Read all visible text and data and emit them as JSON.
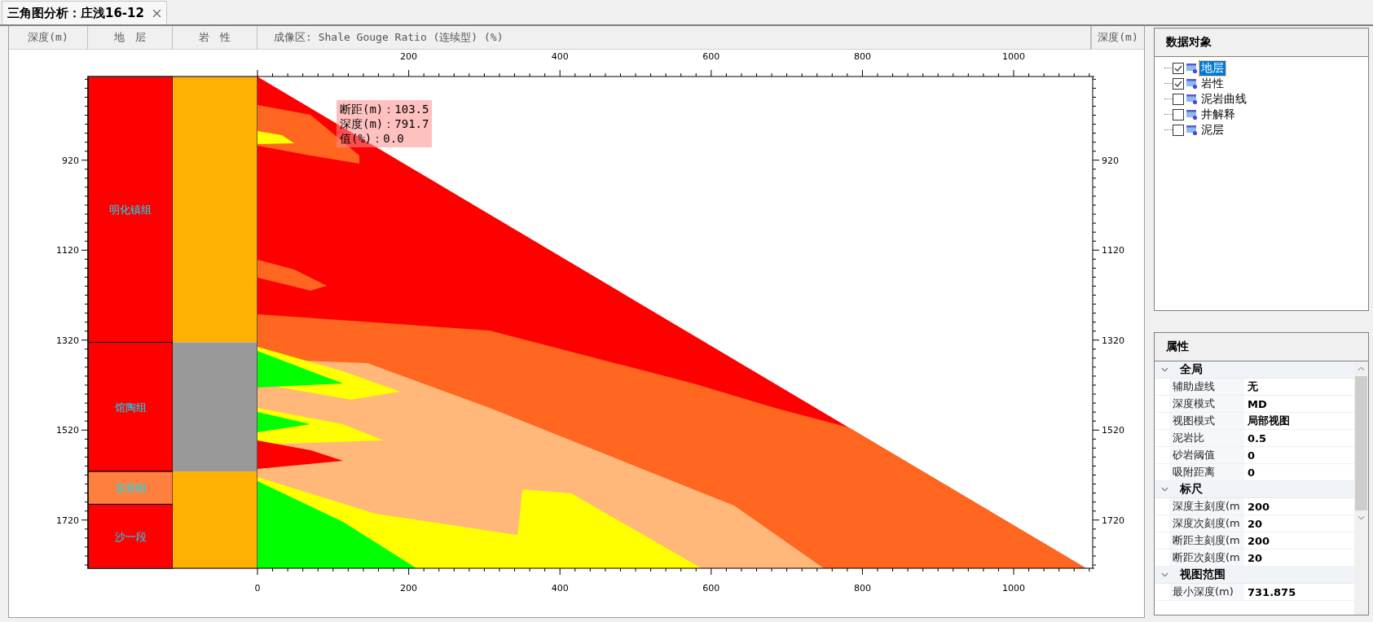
{
  "tab": {
    "title": "三角图分析：庄浅16-12",
    "selected": true
  },
  "header": {
    "columns": [
      "深度(m)",
      "地　层",
      "岩　性",
      "成像区: Shale Gouge Ratio (连续型) (%)",
      "深度(m)"
    ]
  },
  "plot": {
    "top_axis_labels": [
      "200",
      "400",
      "600",
      "800",
      "1000"
    ],
    "bottom_axis_labels": [
      "0",
      "200",
      "400",
      "600",
      "800",
      "1000"
    ],
    "left_axis_labels": [
      "920",
      "1120",
      "1320",
      "1520",
      "1720"
    ],
    "right_axis_labels": [
      "920",
      "1120",
      "1320",
      "1520",
      "1720"
    ],
    "strata": [
      {
        "name": "明化镇组",
        "color": "#ff0000"
      },
      {
        "name": "馆陶组",
        "color": "#ff0000"
      },
      {
        "name": "东营组",
        "color": "#ff7f3f"
      },
      {
        "name": "沙一段",
        "color": "#ff0000"
      }
    ],
    "lithology": [
      {
        "color": "#ffb000"
      },
      {
        "color": "#999999"
      },
      {
        "color": "#ffb000"
      }
    ],
    "tooltip": [
      "断距(m)：103.5",
      "深度(m)：791.7",
      "值(%)：0.0"
    ]
  },
  "data_objects": {
    "title": "数据对象",
    "items": [
      {
        "label": "地层",
        "checked": true,
        "selected": true
      },
      {
        "label": "岩性",
        "checked": true,
        "selected": false
      },
      {
        "label": "泥岩曲线",
        "checked": false,
        "selected": false
      },
      {
        "label": "井解释",
        "checked": false,
        "selected": false
      },
      {
        "label": "泥层",
        "checked": false,
        "selected": false
      }
    ]
  },
  "properties": {
    "title": "属性",
    "groups": [
      {
        "label": "全局",
        "expanded": true,
        "rows": [
          {
            "name": "辅助虚线",
            "value": "无"
          },
          {
            "name": "深度模式",
            "value": "MD"
          },
          {
            "name": "视图模式",
            "value": "局部视图"
          },
          {
            "name": "泥岩比",
            "value": "0.5"
          },
          {
            "name": "砂岩阈值",
            "value": "0"
          },
          {
            "name": "吸附距离",
            "value": "0"
          }
        ]
      },
      {
        "label": "标尺",
        "expanded": true,
        "rows": [
          {
            "name": "深度主刻度(m",
            "value": "200"
          },
          {
            "name": "深度次刻度(m",
            "value": "20"
          },
          {
            "name": "断距主刻度(m",
            "value": "200"
          },
          {
            "name": "断距次刻度(m",
            "value": "20"
          }
        ]
      },
      {
        "label": "视图范围",
        "expanded": true,
        "rows": [
          {
            "name": "最小深度(m)",
            "value": "731.875"
          }
        ]
      }
    ]
  }
}
